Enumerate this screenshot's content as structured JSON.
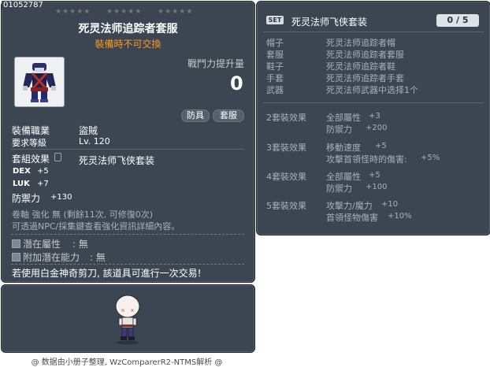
{
  "item": {
    "item_id": "01052787",
    "star_groups": [
      "★★★★★",
      "★★★★★",
      "★★★★★"
    ],
    "name": "死灵法师追踪者套服",
    "trade_notice": "裝備時不可交換",
    "power_label": "戰鬥力提升量",
    "power_value": "0",
    "tags": [
      "防具",
      "套服"
    ],
    "job_label": "裝備職業",
    "job_value": "盜賊",
    "level_label": "要求等級",
    "level_value": "Lv. 120",
    "set_effect_label": "套組效果",
    "set_effect_value": "死灵法师飞侠套装",
    "stats": [
      {
        "label": "DEX",
        "value": "+5"
      },
      {
        "label": "LUK",
        "value": "+7"
      },
      {
        "label": "防禦力",
        "value": "+130"
      }
    ],
    "upgrade_line": "卷軸 強化 無 (剩餘11次, 可修復0次)",
    "npc_line": "可透過NPC/採集鍵查看強化資訊詳細內容。",
    "potential_label": "潛在屬性",
    "potential_value": ": 無",
    "bonus_potential_label": "附加潛在能力",
    "bonus_potential_value": ": 無",
    "scissors_notice": "若使用白金神奇剪刀, 該道具可進行一次交易!"
  },
  "set": {
    "badge": "SET",
    "title": "死灵法师飞侠套装",
    "count": "0 / 5",
    "pieces": [
      {
        "slot": "帽子",
        "name": "死灵法师追踪者帽"
      },
      {
        "slot": "套服",
        "name": "死灵法师追踪者套服"
      },
      {
        "slot": "鞋子",
        "name": "死灵法师追踪者鞋"
      },
      {
        "slot": "手套",
        "name": "死灵法师追踪者手套"
      },
      {
        "slot": "武器",
        "name": "死灵法师武器中选择1个"
      }
    ],
    "effects": [
      {
        "tier": "2套裝效果",
        "lines": [
          {
            "name": "全部屬性",
            "value": "+3"
          },
          {
            "name": "防禦力",
            "value": "+200"
          }
        ]
      },
      {
        "tier": "3套裝效果",
        "lines": [
          {
            "name": "移動速度",
            "value": "+5"
          },
          {
            "name": "攻擊首領怪時的傷害:",
            "value": "+5%"
          }
        ]
      },
      {
        "tier": "4套裝效果",
        "lines": [
          {
            "name": "全部屬性",
            "value": "+5"
          },
          {
            "name": "防禦力",
            "value": "+100"
          }
        ]
      },
      {
        "tier": "5套裝效果",
        "lines": [
          {
            "name": "攻擊力/魔力",
            "value": "+10"
          },
          {
            "name": "首領怪物傷害",
            "value": "+10%"
          }
        ]
      }
    ]
  },
  "footer": {
    "credit": "@ 数据由小册子整理, WzComparerR2-NTMS解析 @"
  },
  "colors": {
    "panel": "#3c4653",
    "accent_orange": "#ff9a1a",
    "text": "#ffffff"
  }
}
